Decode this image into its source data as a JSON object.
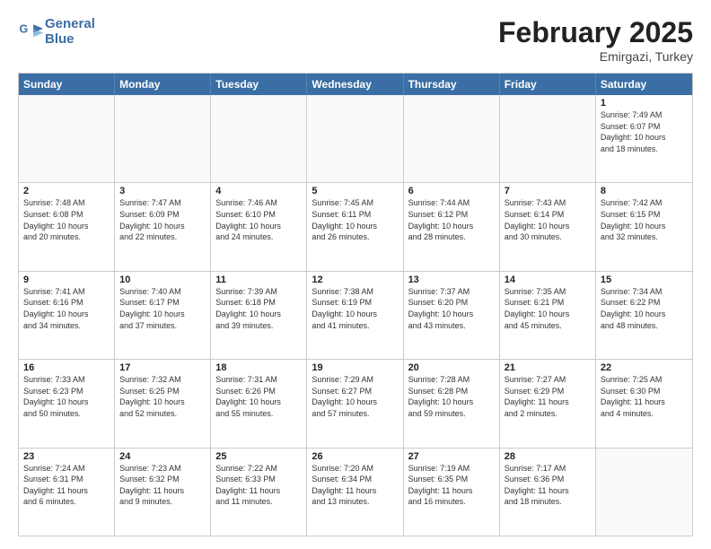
{
  "header": {
    "logo_line1": "General",
    "logo_line2": "Blue",
    "month": "February 2025",
    "location": "Emirgazi, Turkey"
  },
  "weekdays": [
    "Sunday",
    "Monday",
    "Tuesday",
    "Wednesday",
    "Thursday",
    "Friday",
    "Saturday"
  ],
  "rows": [
    [
      {
        "day": "",
        "info": ""
      },
      {
        "day": "",
        "info": ""
      },
      {
        "day": "",
        "info": ""
      },
      {
        "day": "",
        "info": ""
      },
      {
        "day": "",
        "info": ""
      },
      {
        "day": "",
        "info": ""
      },
      {
        "day": "1",
        "info": "Sunrise: 7:49 AM\nSunset: 6:07 PM\nDaylight: 10 hours\nand 18 minutes."
      }
    ],
    [
      {
        "day": "2",
        "info": "Sunrise: 7:48 AM\nSunset: 6:08 PM\nDaylight: 10 hours\nand 20 minutes."
      },
      {
        "day": "3",
        "info": "Sunrise: 7:47 AM\nSunset: 6:09 PM\nDaylight: 10 hours\nand 22 minutes."
      },
      {
        "day": "4",
        "info": "Sunrise: 7:46 AM\nSunset: 6:10 PM\nDaylight: 10 hours\nand 24 minutes."
      },
      {
        "day": "5",
        "info": "Sunrise: 7:45 AM\nSunset: 6:11 PM\nDaylight: 10 hours\nand 26 minutes."
      },
      {
        "day": "6",
        "info": "Sunrise: 7:44 AM\nSunset: 6:12 PM\nDaylight: 10 hours\nand 28 minutes."
      },
      {
        "day": "7",
        "info": "Sunrise: 7:43 AM\nSunset: 6:14 PM\nDaylight: 10 hours\nand 30 minutes."
      },
      {
        "day": "8",
        "info": "Sunrise: 7:42 AM\nSunset: 6:15 PM\nDaylight: 10 hours\nand 32 minutes."
      }
    ],
    [
      {
        "day": "9",
        "info": "Sunrise: 7:41 AM\nSunset: 6:16 PM\nDaylight: 10 hours\nand 34 minutes."
      },
      {
        "day": "10",
        "info": "Sunrise: 7:40 AM\nSunset: 6:17 PM\nDaylight: 10 hours\nand 37 minutes."
      },
      {
        "day": "11",
        "info": "Sunrise: 7:39 AM\nSunset: 6:18 PM\nDaylight: 10 hours\nand 39 minutes."
      },
      {
        "day": "12",
        "info": "Sunrise: 7:38 AM\nSunset: 6:19 PM\nDaylight: 10 hours\nand 41 minutes."
      },
      {
        "day": "13",
        "info": "Sunrise: 7:37 AM\nSunset: 6:20 PM\nDaylight: 10 hours\nand 43 minutes."
      },
      {
        "day": "14",
        "info": "Sunrise: 7:35 AM\nSunset: 6:21 PM\nDaylight: 10 hours\nand 45 minutes."
      },
      {
        "day": "15",
        "info": "Sunrise: 7:34 AM\nSunset: 6:22 PM\nDaylight: 10 hours\nand 48 minutes."
      }
    ],
    [
      {
        "day": "16",
        "info": "Sunrise: 7:33 AM\nSunset: 6:23 PM\nDaylight: 10 hours\nand 50 minutes."
      },
      {
        "day": "17",
        "info": "Sunrise: 7:32 AM\nSunset: 6:25 PM\nDaylight: 10 hours\nand 52 minutes."
      },
      {
        "day": "18",
        "info": "Sunrise: 7:31 AM\nSunset: 6:26 PM\nDaylight: 10 hours\nand 55 minutes."
      },
      {
        "day": "19",
        "info": "Sunrise: 7:29 AM\nSunset: 6:27 PM\nDaylight: 10 hours\nand 57 minutes."
      },
      {
        "day": "20",
        "info": "Sunrise: 7:28 AM\nSunset: 6:28 PM\nDaylight: 10 hours\nand 59 minutes."
      },
      {
        "day": "21",
        "info": "Sunrise: 7:27 AM\nSunset: 6:29 PM\nDaylight: 11 hours\nand 2 minutes."
      },
      {
        "day": "22",
        "info": "Sunrise: 7:25 AM\nSunset: 6:30 PM\nDaylight: 11 hours\nand 4 minutes."
      }
    ],
    [
      {
        "day": "23",
        "info": "Sunrise: 7:24 AM\nSunset: 6:31 PM\nDaylight: 11 hours\nand 6 minutes."
      },
      {
        "day": "24",
        "info": "Sunrise: 7:23 AM\nSunset: 6:32 PM\nDaylight: 11 hours\nand 9 minutes."
      },
      {
        "day": "25",
        "info": "Sunrise: 7:22 AM\nSunset: 6:33 PM\nDaylight: 11 hours\nand 11 minutes."
      },
      {
        "day": "26",
        "info": "Sunrise: 7:20 AM\nSunset: 6:34 PM\nDaylight: 11 hours\nand 13 minutes."
      },
      {
        "day": "27",
        "info": "Sunrise: 7:19 AM\nSunset: 6:35 PM\nDaylight: 11 hours\nand 16 minutes."
      },
      {
        "day": "28",
        "info": "Sunrise: 7:17 AM\nSunset: 6:36 PM\nDaylight: 11 hours\nand 18 minutes."
      },
      {
        "day": "",
        "info": ""
      }
    ]
  ]
}
